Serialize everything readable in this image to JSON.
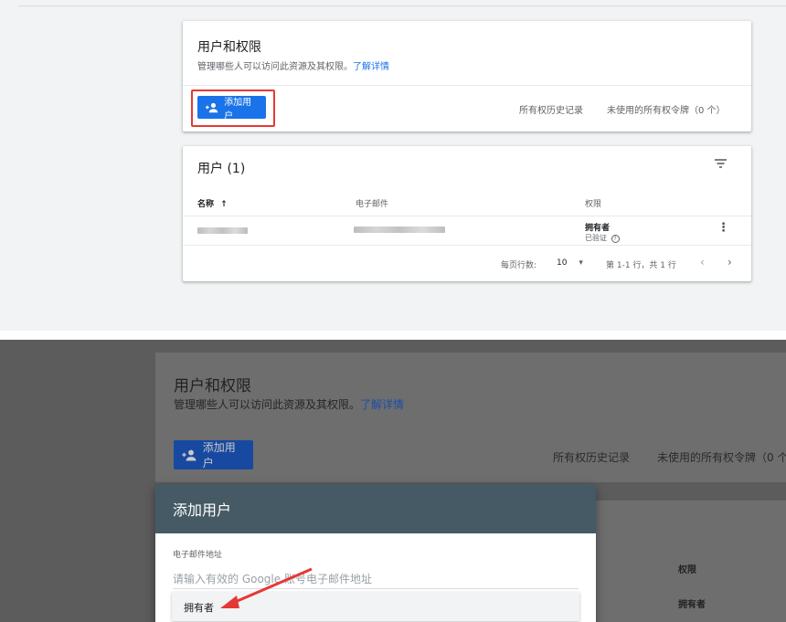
{
  "top": {
    "card1": {
      "title": "用户和权限",
      "subtitle": "管理哪些人可以访问此资源及其权限。",
      "learn_more": "了解详情",
      "add_user_label": "添加用户",
      "history_link": "所有权历史记录",
      "unused_tokens": "未使用的所有权令牌（0 个）"
    },
    "card2": {
      "title": "用户 (1)",
      "columns": {
        "name": "名称",
        "email": "电子邮件",
        "permission": "权限"
      },
      "row": {
        "permission": "拥有者",
        "verified": "已验证"
      },
      "pagination": {
        "rows_per_page_label": "每页行数:",
        "rows_per_page_value": "10",
        "range": "第 1-1 行，共 1 行"
      }
    }
  },
  "bottom": {
    "bg_title": "用户和权限",
    "bg_subtitle": "管理哪些人可以访问此资源及其权限。",
    "bg_learn_more": "了解详情",
    "bg_add_user": "添加用户",
    "bg_history": "所有权历史记录",
    "bg_unused": "未使用的所有权令牌（0 个",
    "bg_col_permission": "权限",
    "bg_row_permission": "拥有者",
    "dialog": {
      "title": "添加用户",
      "email_label": "电子邮件地址",
      "email_placeholder": "请输入有效的 Google 账号电子邮件地址",
      "option": "拥有者"
    }
  },
  "colors": {
    "accent": "#1a73e8",
    "highlight": "#e53935",
    "dialog_header": "#455a64"
  },
  "icons": [
    "add-person-icon",
    "sort-up-icon",
    "filter-icon",
    "more-vert-icon",
    "help-icon",
    "dropdown-arrow-icon",
    "chevron-left-icon",
    "chevron-right-icon",
    "arrow-annotation-icon"
  ]
}
